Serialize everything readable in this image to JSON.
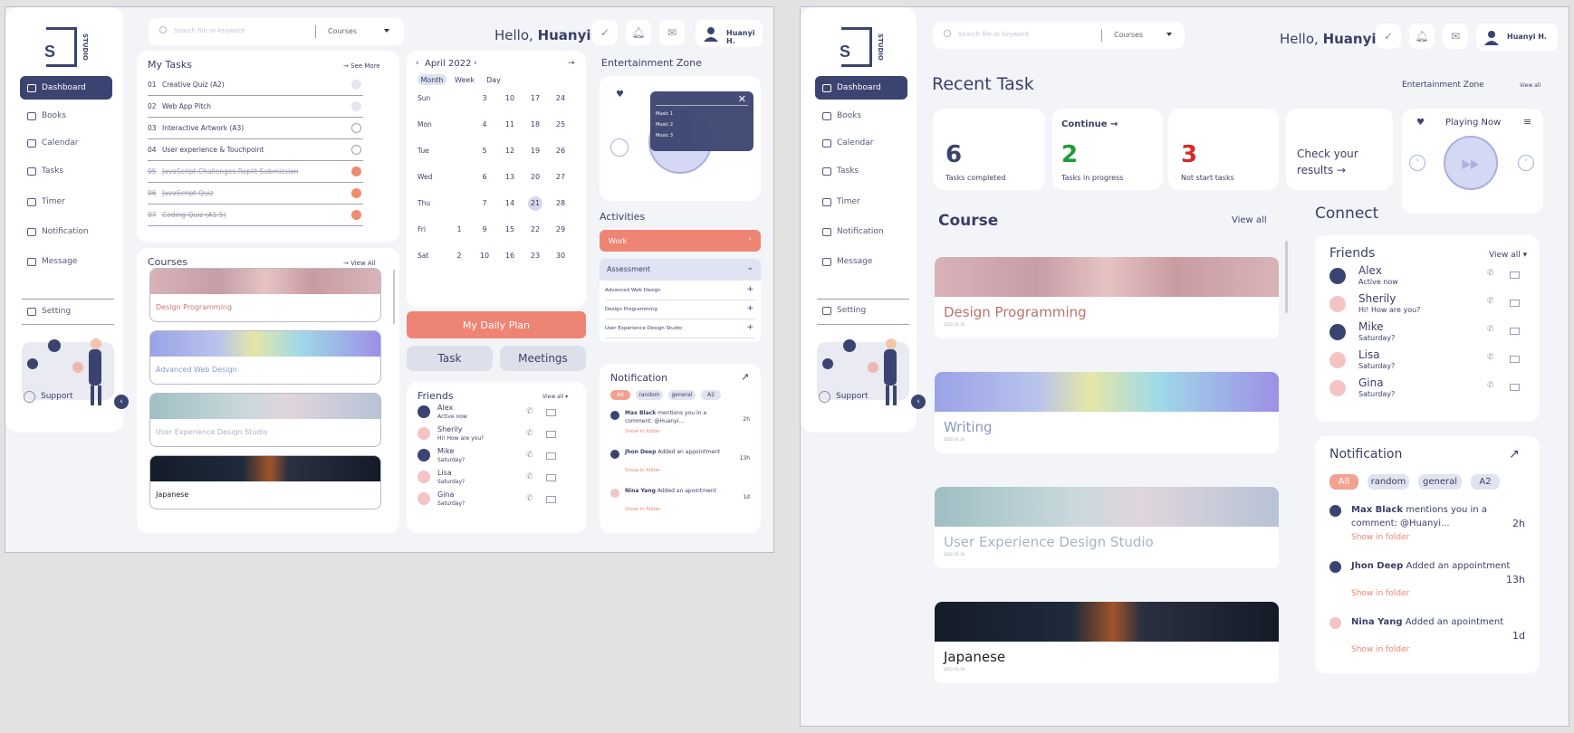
{
  "brand": {
    "letter": "S",
    "word": "STUDIO"
  },
  "nav": [
    {
      "label": "Dashboard",
      "icon": "dashboard-icon"
    },
    {
      "label": "Books",
      "icon": "book-icon"
    },
    {
      "label": "Calendar",
      "icon": "calendar-icon"
    },
    {
      "label": "Tasks",
      "icon": "tasks-icon"
    },
    {
      "label": "Timer",
      "icon": "clock-icon"
    },
    {
      "label": "Notification",
      "icon": "bell-icon"
    },
    {
      "label": "Message",
      "icon": "message-icon"
    }
  ],
  "setting": "Setting",
  "support": "Support",
  "search": {
    "placeholder": "Search file or keyword",
    "select": "Courses"
  },
  "greeting": {
    "hello": "Hello,",
    "name": "Huanyi"
  },
  "user": "Huanyi H.",
  "tasks": {
    "title": "My Tasks",
    "see_more": "See More",
    "items": [
      {
        "n": "01",
        "label": "Creative Quiz (A2)",
        "state": "arrow"
      },
      {
        "n": "02",
        "label": "Web App Pitch",
        "state": "arrow"
      },
      {
        "n": "03",
        "label": "Interactive Artwork (A3)",
        "state": "open"
      },
      {
        "n": "04",
        "label": "User experience & Touchpoint",
        "state": "open"
      },
      {
        "n": "05",
        "label": "JavaScript Challenges Replit Submission",
        "state": "done"
      },
      {
        "n": "06",
        "label": "JavaScript Quiz",
        "state": "done"
      },
      {
        "n": "07",
        "label": "Coding Quiz (A1.5)",
        "state": "done"
      }
    ]
  },
  "courses_left": {
    "title": "Courses",
    "view_all": "View All",
    "items": [
      "Design Programming",
      "Advanced Web Design",
      "User Experience Design Studio",
      "Japanese"
    ]
  },
  "calendar": {
    "month": "April 2022",
    "views": [
      "Month",
      "Week",
      "Day"
    ],
    "days": [
      "Sun",
      "Mon",
      "Tue",
      "Wed",
      "Thu",
      "Fri",
      "Sat"
    ],
    "weeks": [
      [
        "",
        "",
        "1",
        "2"
      ],
      [
        "3",
        "4",
        "5",
        "6",
        "7",
        "8",
        "9",
        "10"
      ],
      [
        "10",
        "11",
        "12",
        "13",
        "14",
        "15",
        "16"
      ],
      [
        "17",
        "18",
        "19",
        "20",
        "21",
        "22",
        "23"
      ],
      [
        "24",
        "25",
        "26",
        "27",
        "28",
        "29",
        "30"
      ]
    ],
    "grid": [
      [
        "",
        "3",
        "10",
        "17",
        "24"
      ],
      [
        "",
        "4",
        "11",
        "18",
        "25"
      ],
      [
        "",
        "5",
        "12",
        "19",
        "26"
      ],
      [
        "",
        "6",
        "13",
        "20",
        "27"
      ],
      [
        "",
        "7",
        "14",
        "21",
        "28"
      ],
      [
        "1",
        "9",
        "15",
        "22",
        "29"
      ],
      [
        "2",
        "10",
        "16",
        "23",
        "30"
      ]
    ],
    "selected": "21"
  },
  "daily_plan": "My Daily Plan",
  "task_btn": "Task",
  "meetings_btn": "Meetings",
  "friends": {
    "title": "Friends",
    "view_all": "View all",
    "items": [
      {
        "name": "Alex",
        "status": "Active now",
        "av": "n"
      },
      {
        "name": "Sherily",
        "status": "Hi! How are you?",
        "av": "p"
      },
      {
        "name": "Mike",
        "status": "Saturday?",
        "av": "n"
      },
      {
        "name": "Lisa",
        "status": "Saturday?",
        "av": "p"
      },
      {
        "name": "Gina",
        "status": "Saturday?",
        "av": "p"
      }
    ]
  },
  "ent": {
    "title": "Entertainment Zone",
    "view_all": "View all",
    "playing": "Playing Now",
    "music": [
      "Music 1",
      "Music 2",
      "Music 3"
    ]
  },
  "activities": {
    "title": "Activities",
    "work": "Work",
    "assessment": "Assessment",
    "items": [
      "Advanced Web Design",
      "Design Programming",
      "User Experience Design Studio"
    ]
  },
  "notification": {
    "title": "Notification",
    "filters": [
      "All",
      "random",
      "general",
      "A2"
    ],
    "items": [
      {
        "name": "Max Black",
        "text": "mentions you in a comment: @Huanyi...",
        "time": "2h",
        "link": "Show in folder"
      },
      {
        "name": "Jhon Deep",
        "text": "Added an appointment",
        "time": "13h",
        "link": "Show in folder"
      },
      {
        "name": "Nina Yang",
        "text": "Added an apointment",
        "time": "1d",
        "link": "Show in folder"
      }
    ]
  },
  "recent": {
    "title": "Recent Task",
    "stats": [
      {
        "num": "6",
        "label": "Tasks completed",
        "color": "#3b4470"
      },
      {
        "num": "2",
        "label": "Tasks in progress",
        "color": "#1f9a3a"
      },
      {
        "num": "3",
        "label": "Not start tasks",
        "color": "#d42a2a"
      }
    ],
    "continue": "Continue →",
    "check": "Check your results →"
  },
  "course_right": {
    "title": "Course",
    "view_all": "View all",
    "items": [
      {
        "t": "Design Programming",
        "d": "2022.03.18",
        "g": "g1",
        "c": "#b8756c"
      },
      {
        "t": "Writing",
        "d": "2022.03.18",
        "g": "g2",
        "c": "#8a96c8"
      },
      {
        "t": "User Experience Design Studio",
        "d": "2022.03.18",
        "g": "g3",
        "c": "#a8b4c0"
      },
      {
        "t": "Japanese",
        "d": "2022.03.18",
        "g": "g4",
        "c": "#222"
      }
    ]
  },
  "connect": "Connect"
}
